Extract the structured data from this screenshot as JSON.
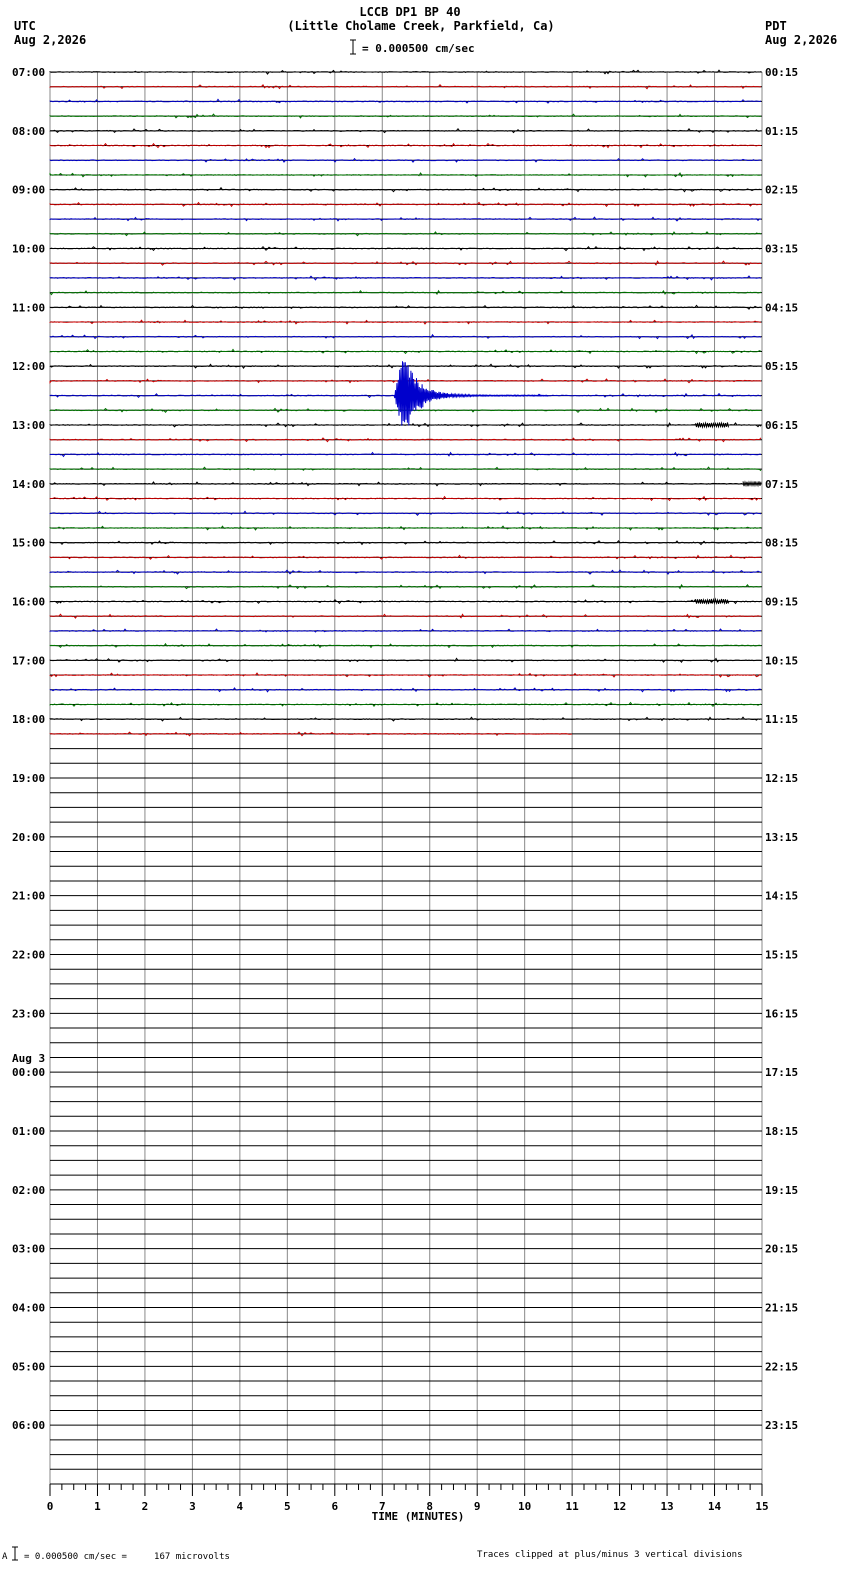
{
  "header": {
    "title": "LCCB DP1 BP 40",
    "subtitle": "(Little Cholame Creek, Parkfield, Ca)",
    "scale_label": "= 0.000500 cm/sec",
    "left_zone": "UTC",
    "left_date": "Aug 2,2026",
    "right_zone": "PDT",
    "right_date": "Aug 2,2026"
  },
  "footer": {
    "scale_note": "= 0.000500 cm/sec =     167 microvolts",
    "scale_prefix": "A",
    "clip_note": "Traces clipped at plus/minus 3 vertical divisions"
  },
  "chart_data": {
    "type": "line",
    "xlabel": "TIME (MINUTES)",
    "xlim": [
      0,
      15
    ],
    "x_ticks": [
      "0",
      "1",
      "2",
      "3",
      "4",
      "5",
      "6",
      "7",
      "8",
      "9",
      "10",
      "11",
      "12",
      "13",
      "14",
      "15"
    ],
    "rows_per_hour": 4,
    "total_rows": 96,
    "grid": true,
    "trace_colors": [
      "#000000",
      "#cc0000",
      "#0000cc",
      "#007700"
    ],
    "utc_labels": [
      "07:00",
      "08:00",
      "09:00",
      "10:00",
      "11:00",
      "12:00",
      "13:00",
      "14:00",
      "15:00",
      "16:00",
      "17:00",
      "18:00",
      "19:00",
      "20:00",
      "21:00",
      "22:00",
      "23:00",
      "00:00",
      "01:00",
      "02:00",
      "03:00",
      "04:00",
      "05:00",
      "06:00"
    ],
    "date_change_label": "Aug 3",
    "date_change_hour_index": 17,
    "pdt_labels": [
      "00:15",
      "01:15",
      "02:15",
      "03:15",
      "04:15",
      "05:15",
      "06:15",
      "07:15",
      "08:15",
      "09:15",
      "10:15",
      "11:15",
      "12:15",
      "13:15",
      "14:15",
      "15:15",
      "16:15",
      "17:15",
      "18:15",
      "19:15",
      "20:15",
      "21:15",
      "22:15",
      "23:15"
    ],
    "data_rows": 46,
    "last_row_end_minute": 11,
    "events": [
      {
        "row": 22,
        "start_minute": 7.25,
        "peak_minute": 7.45,
        "end_minute": 10.5,
        "color": "#0000cc",
        "clipped": true
      },
      {
        "row": 24,
        "start_minute": 13.6,
        "end_minute": 14.3,
        "color": "#000000",
        "clipped": false
      },
      {
        "row": 28,
        "start_minute": 14.6,
        "end_minute": 15.0,
        "color": "#000000",
        "clipped": false
      },
      {
        "row": 36,
        "start_minute": 13.6,
        "end_minute": 14.3,
        "color": "#000000",
        "clipped": false
      }
    ]
  }
}
